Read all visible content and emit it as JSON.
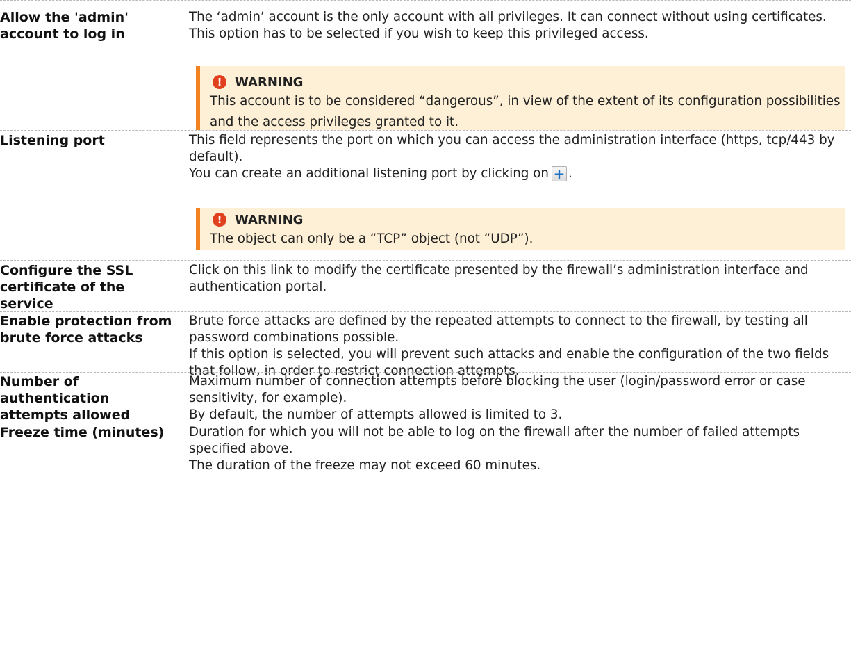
{
  "rows": [
    {
      "term": "Allow the 'admin' account to log in",
      "lines": [
        "The ‘admin’ account is the only account with all privileges. It can connect without using certificates.",
        "This option has to be selected if you wish to keep this privileged access."
      ],
      "warning": {
        "title": "WARNING",
        "text": "This account is to be considered “dangerous”, in view of the extent of its configuration possibilities and the access privileges granted to it."
      }
    },
    {
      "term": "Listening port",
      "lines": [
        "This field represents the port on which you can access the administration interface (https, tcp/443 by default).",
        "You can create an additional listening port by clicking on"
      ],
      "line_suffix": ".",
      "add_icon": "plus-icon",
      "warning": {
        "title": "WARNING",
        "text": "The object can only be a “TCP” object (not “UDP”)."
      }
    },
    {
      "term": "Configure the SSL certificate of the service",
      "lines": [
        "Click on this link to modify the certificate presented by the firewall’s administration interface and authentication portal."
      ]
    },
    {
      "term": "Enable protection from brute force attacks",
      "lines": [
        "Brute force attacks are defined by the repeated attempts to connect to the firewall, by testing all password combinations possible.",
        "If this option is selected, you will prevent such attacks and enable the configuration of the two fields that follow, in order to restrict connection attempts."
      ]
    },
    {
      "term": "Number of authentication attempts allowed",
      "lines": [
        "Maximum number of connection attempts before blocking the user (login/password error or case sensitivity, for example).",
        "By default, the number of attempts allowed is limited to 3."
      ]
    },
    {
      "term": "Freeze time (minutes)",
      "lines": [
        "Duration for which you will not be able to log on the firewall after the number of failed attempts specified above.",
        "The duration of the freeze may not exceed 60 minutes."
      ]
    }
  ],
  "colors": {
    "warning_bg": "#fdf0d6",
    "warning_bar": "#f58220",
    "warning_icon": "#e0401e",
    "add_icon": "#1f6fc4"
  }
}
